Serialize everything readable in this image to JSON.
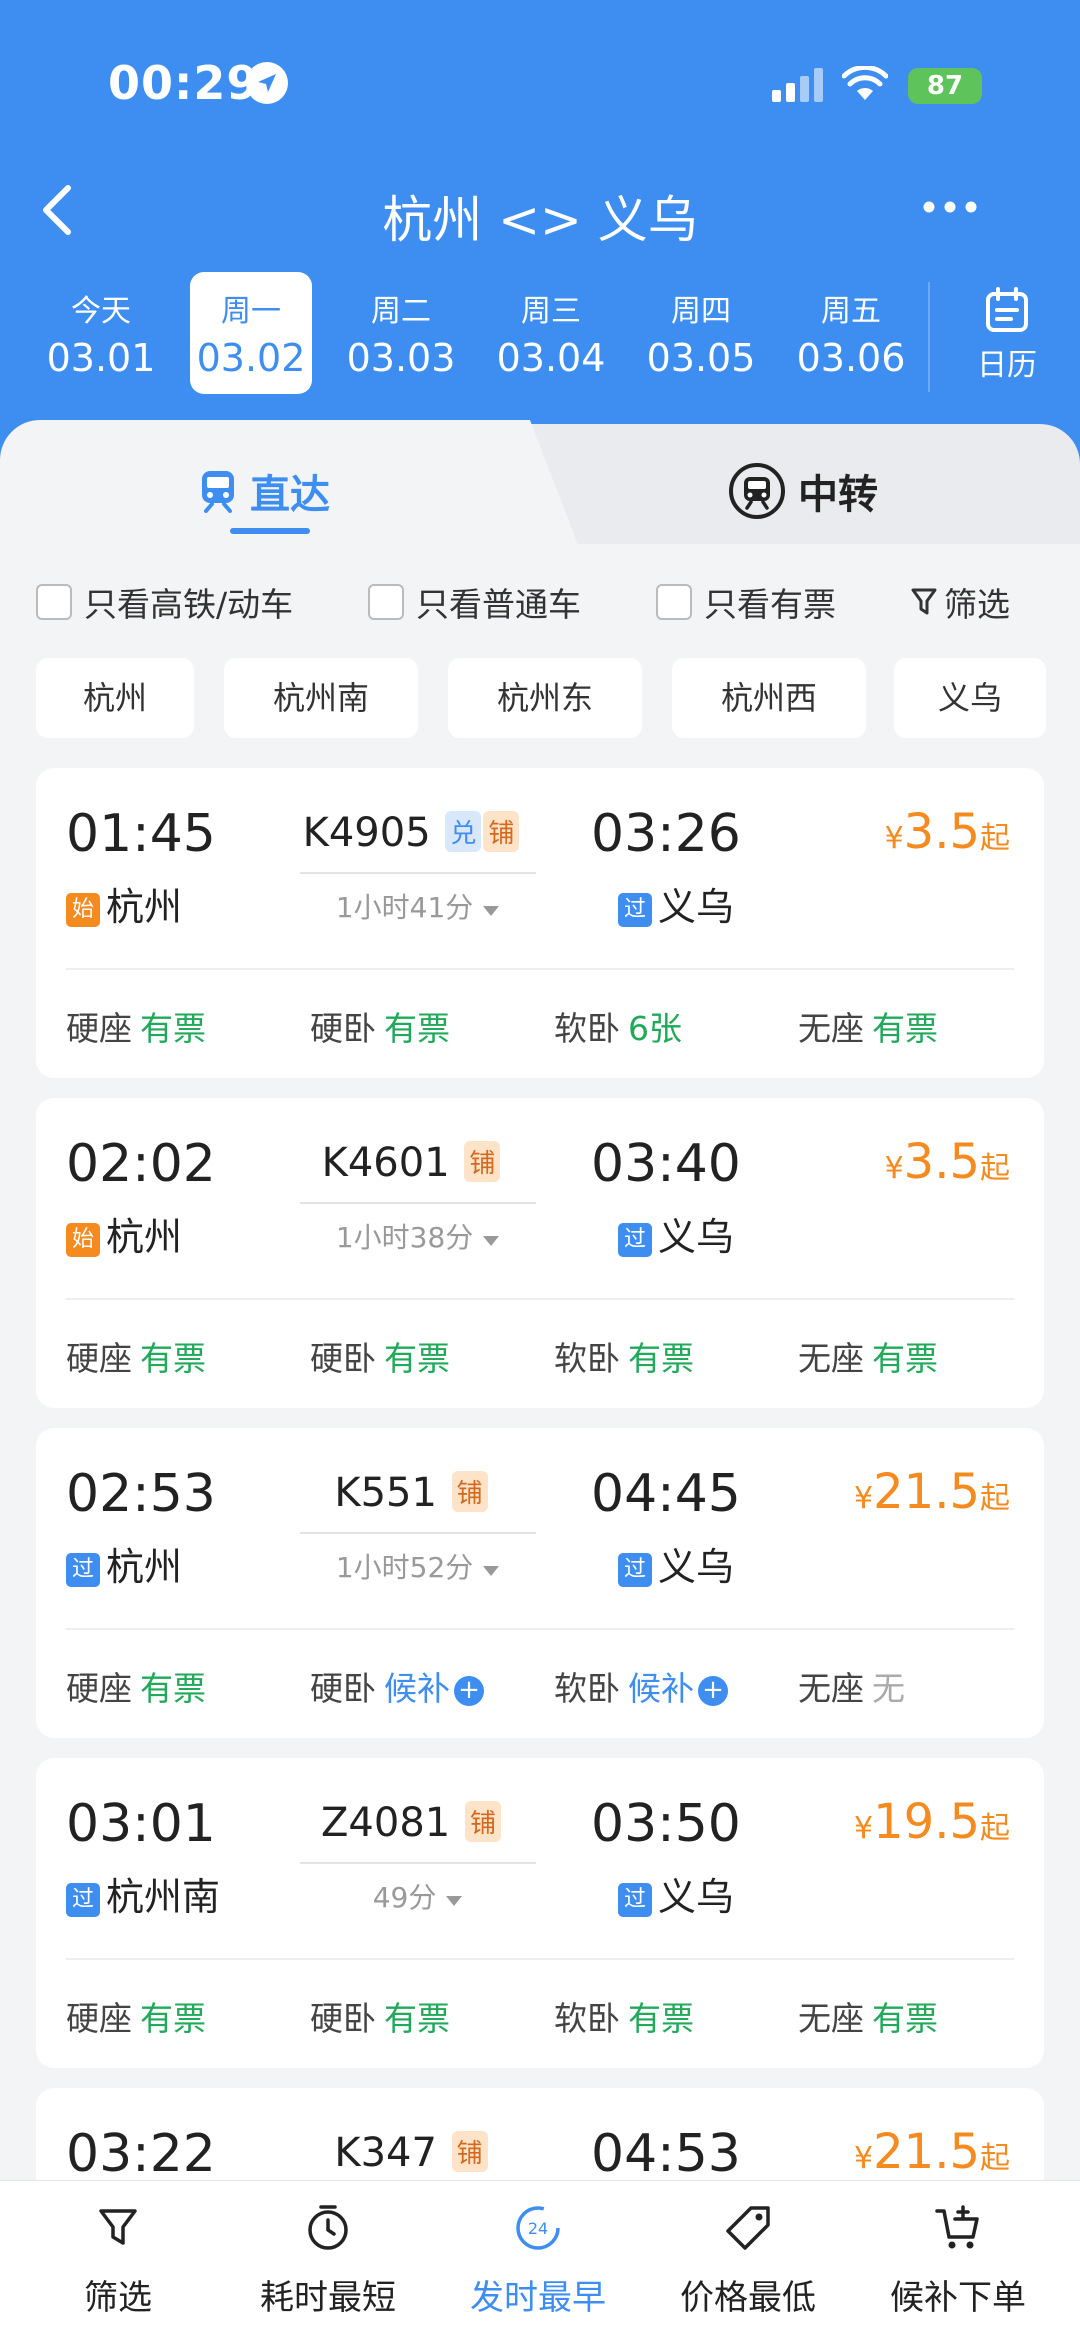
{
  "status_bar": {
    "time": "00:29",
    "battery": "87"
  },
  "nav": {
    "title": "杭州 <> 义乌"
  },
  "dates": [
    {
      "weekday": "今天",
      "date": "03.01"
    },
    {
      "weekday": "周一",
      "date": "03.02"
    },
    {
      "weekday": "周二",
      "date": "03.03"
    },
    {
      "weekday": "周三",
      "date": "03.04"
    },
    {
      "weekday": "周四",
      "date": "03.05"
    },
    {
      "weekday": "周五",
      "date": "03.06"
    }
  ],
  "calendar_label": "日历",
  "tabs": {
    "direct": "直达",
    "transfer": "中转"
  },
  "filters": {
    "hsr": "只看高铁/动车",
    "normal": "只看普通车",
    "available": "只看有票",
    "screen": "筛选"
  },
  "stations": [
    "杭州",
    "杭州南",
    "杭州东",
    "杭州西",
    "义乌"
  ],
  "labels": {
    "start": "始",
    "pass": "过",
    "yen": "¥",
    "from": "起",
    "pu": "铺",
    "dui": "兑"
  },
  "trains": [
    {
      "dep_time": "01:45",
      "train_no": "K4905",
      "dui": true,
      "duration": "1小时41分",
      "arr_time": "03:26",
      "price": "3.5",
      "dep_tag": "始",
      "dep_station": "杭州",
      "arr_station": "义乌",
      "seats": [
        {
          "name": "硬座",
          "status": "有票"
        },
        {
          "name": "硬卧",
          "status": "有票"
        },
        {
          "name": "软卧",
          "status": "6张"
        },
        {
          "name": "无座",
          "status": "有票"
        }
      ]
    },
    {
      "dep_time": "02:02",
      "train_no": "K4601",
      "dui": false,
      "duration": "1小时38分",
      "arr_time": "03:40",
      "price": "3.5",
      "dep_tag": "始",
      "dep_station": "杭州",
      "arr_station": "义乌",
      "seats": [
        {
          "name": "硬座",
          "status": "有票"
        },
        {
          "name": "硬卧",
          "status": "有票"
        },
        {
          "name": "软卧",
          "status": "有票"
        },
        {
          "name": "无座",
          "status": "有票"
        }
      ]
    },
    {
      "dep_time": "02:53",
      "train_no": "K551",
      "dui": false,
      "duration": "1小时52分",
      "arr_time": "04:45",
      "price": "21.5",
      "dep_tag": "过",
      "dep_station": "杭州",
      "arr_station": "义乌",
      "seats": [
        {
          "name": "硬座",
          "status": "有票"
        },
        {
          "name": "硬卧",
          "status": "候补"
        },
        {
          "name": "软卧",
          "status": "候补"
        },
        {
          "name": "无座",
          "status": "无"
        }
      ]
    },
    {
      "dep_time": "03:01",
      "train_no": "Z4081",
      "dui": false,
      "duration": "49分",
      "arr_time": "03:50",
      "price": "19.5",
      "dep_tag": "过",
      "dep_station": "杭州南",
      "arr_station": "义乌",
      "seats": [
        {
          "name": "硬座",
          "status": "有票"
        },
        {
          "name": "硬卧",
          "status": "有票"
        },
        {
          "name": "软卧",
          "status": "有票"
        },
        {
          "name": "无座",
          "status": "有票"
        }
      ]
    },
    {
      "dep_time": "03:22",
      "train_no": "K347",
      "dui": false,
      "arr_time": "04:53",
      "price": "21.5"
    }
  ],
  "bottom_bar": {
    "filter": "筛选",
    "shortest": "耗时最短",
    "earliest": "发时最早",
    "earliest_icon_text": "24",
    "cheapest": "价格最低",
    "waitlist": "候补下单"
  },
  "colors": {
    "primary": "#3d8ef0",
    "price": "#f58a1e",
    "available": "#21a95a",
    "waitlist": "#3d8ef0"
  }
}
